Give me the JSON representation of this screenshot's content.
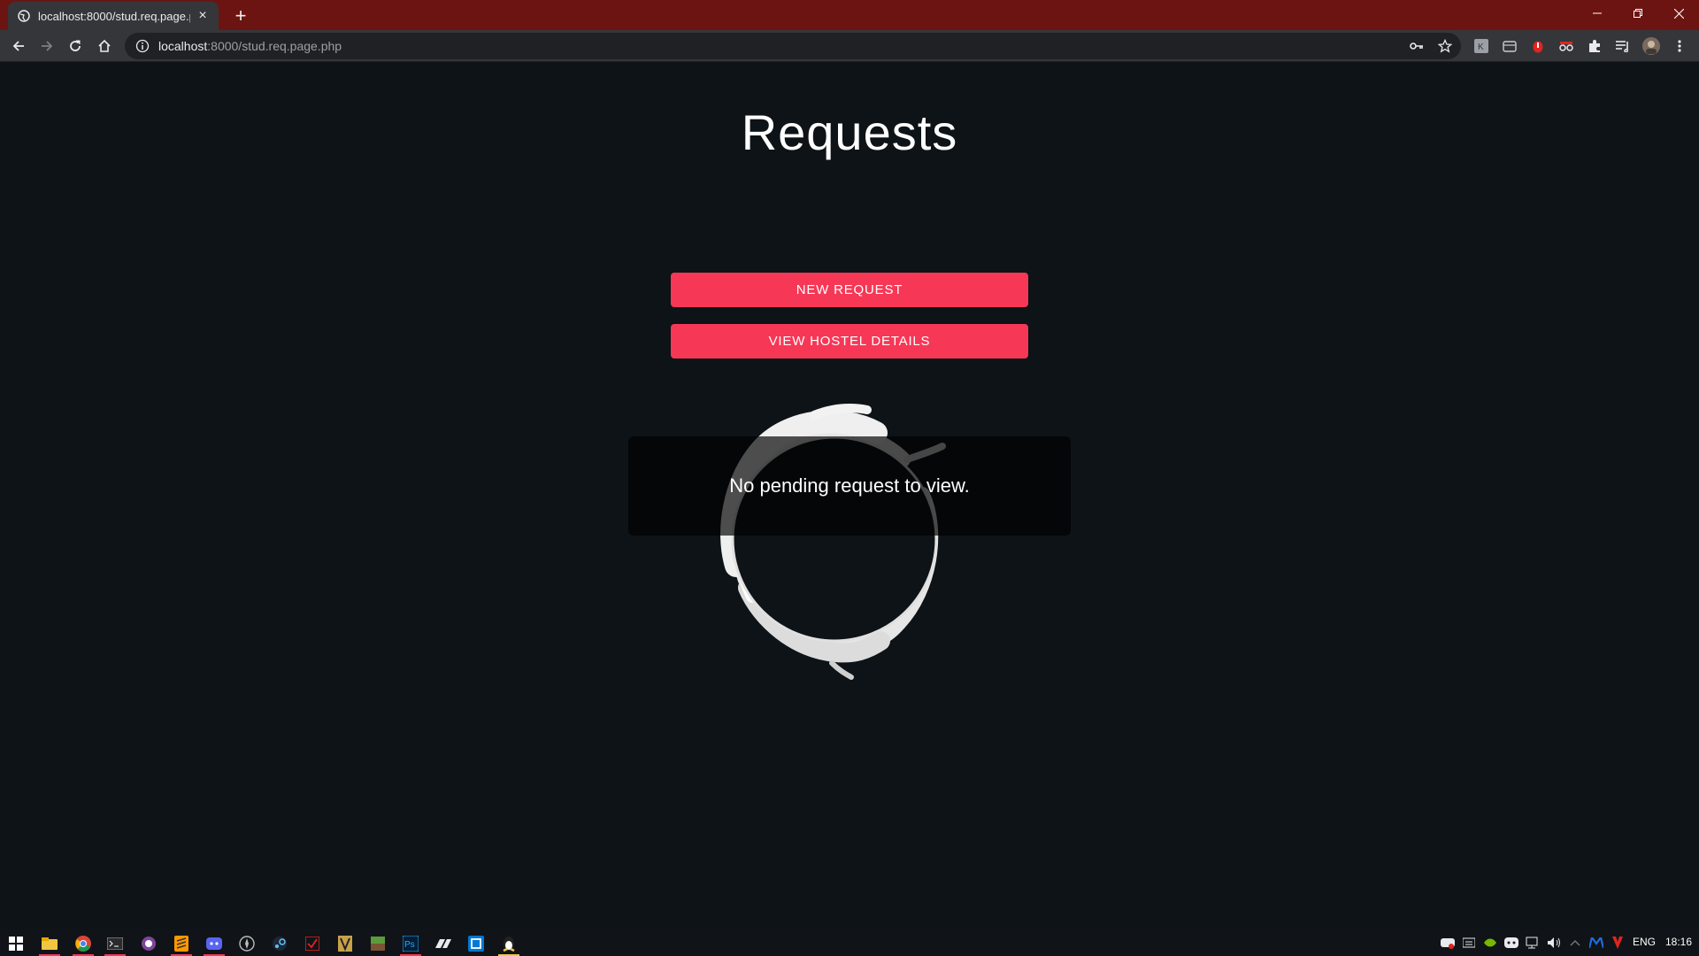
{
  "browser": {
    "tab_title": "localhost:8000/stud.req.page.php",
    "new_tab": "+",
    "url_host": "localhost",
    "url_rest": ":8000/stud.req.page.php"
  },
  "page": {
    "heading": "Requests",
    "buttons": {
      "new_request": "NEW REQUEST",
      "view_hostel": "VIEW HOSTEL DETAILS"
    },
    "message": "No pending request to view."
  },
  "taskbar": {
    "language": "ENG",
    "clock": "18:16"
  },
  "colors": {
    "accent": "#f73756",
    "background": "#0d1317",
    "titlebar": "#6c1411"
  }
}
